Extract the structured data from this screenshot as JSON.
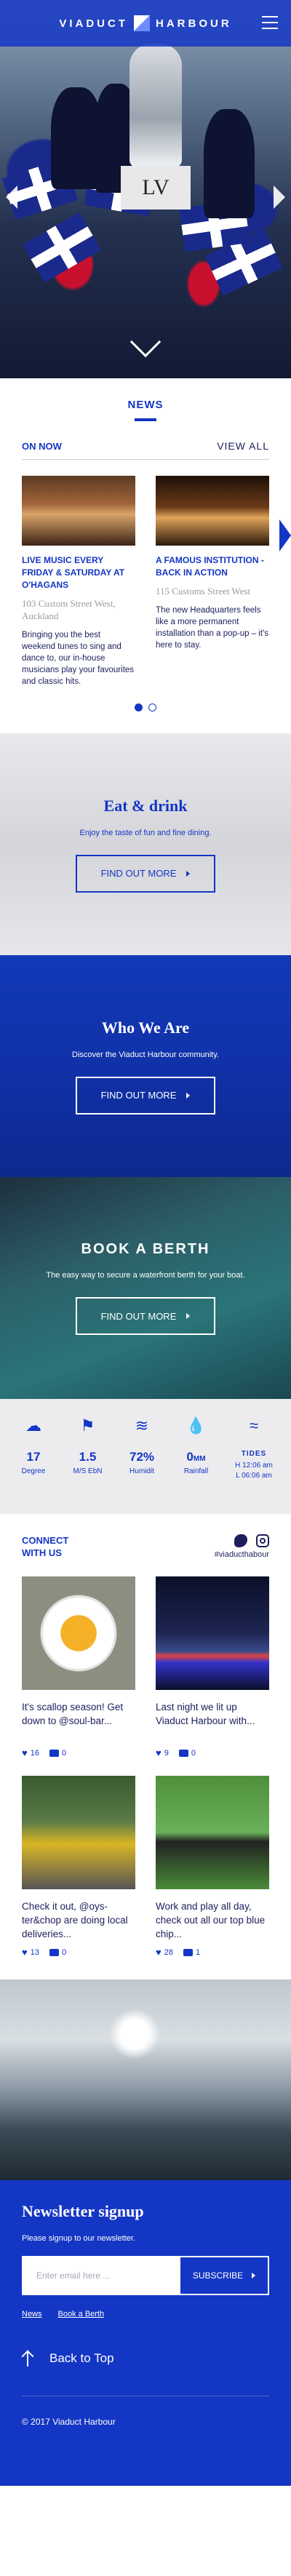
{
  "header": {
    "brand_left": "VIADUCT",
    "brand_right": "HARBOUR"
  },
  "hero": {
    "plinth_text": "LV"
  },
  "news": {
    "title": "NEWS",
    "on_now": "ON NOW",
    "view_all": "VIEW ALL",
    "cards": [
      {
        "title": "LIVE MUSIC EVERY FRIDAY & SATURDAY AT O'HAGANS",
        "address": "103 Custom Street West, Auckland",
        "body": "Bringing you the best weekend tunes to sing and dance to, our in-house musicians play your favourites and classic hits."
      },
      {
        "title": "A FAMOUS INSTITUTION - BACK IN ACTION",
        "address": "115 Customs Street West",
        "body": "The new Headquarters feels like a more permanent installation than a pop-up – it's here to stay."
      }
    ]
  },
  "eat": {
    "title": "Eat & drink",
    "sub": "Enjoy the taste of fun and fine dining.",
    "cta": "FIND OUT MORE"
  },
  "who": {
    "title": "Who We Are",
    "sub": "Discover the Viaduct Harbour community.",
    "cta": "FIND OUT MORE"
  },
  "berth": {
    "title": "BOOK A BERTH",
    "sub": "The easy way to secure a waterfront berth for your boat.",
    "cta": "FIND OUT MORE"
  },
  "weather": {
    "items": [
      {
        "icon": "cloud-icon",
        "value": "17",
        "unit": "",
        "label": "Degree"
      },
      {
        "icon": "wind-flag-icon",
        "value": "1.5",
        "unit": "",
        "label": "M/S EbN"
      },
      {
        "icon": "humidity-icon",
        "value": "72%",
        "unit": "",
        "label": "Humidit"
      },
      {
        "icon": "raindrop-icon",
        "value": "0",
        "unit": "MM",
        "label": "Rainfall"
      }
    ],
    "tides": {
      "icon": "tides-icon",
      "label": "TIDES",
      "high": "H 12:06 am",
      "low": "L 06:06 am"
    }
  },
  "social": {
    "title": "CONNECT WITH US",
    "handle": "#viaducthabour",
    "posts": [
      {
        "caption": "It's scallop season! Get down to @soul-bar...",
        "likes": "16",
        "comments": "0"
      },
      {
        "caption": "Last night we lit up Viaduct Harbour with...",
        "likes": "9",
        "comments": "0"
      },
      {
        "caption": "Check it out, @oys-ter&chop are doing local deliveries...",
        "likes": "13",
        "comments": "0"
      },
      {
        "caption": "Work and play all day, check out all our top blue chip...",
        "likes": "28",
        "comments": "1"
      }
    ]
  },
  "newsletter": {
    "title": "Newsletter signup",
    "lead": "Please signup to our newsletter.",
    "placeholder": "Enter email here ...",
    "submit": "SUBSCRIBE",
    "links": [
      "News",
      "Book a Berth"
    ],
    "back_to_top": "Back to Top",
    "copyright": "© 2017 Viaduct Harbour"
  },
  "colors": {
    "brand_blue": "#1436c4",
    "navy": "#1b1f5c",
    "weather_bg": "#ececef"
  }
}
